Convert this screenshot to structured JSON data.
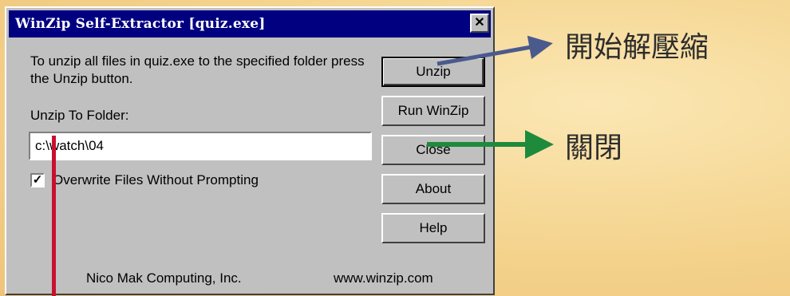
{
  "dialog": {
    "title": "WinZip Self-Extractor [quiz.exe]",
    "close_glyph": "✕",
    "instructions": "To unzip all files in quiz.exe to the specified folder press the Unzip button.",
    "folder_label": "Unzip To Folder:",
    "folder_value": "c:\\watch\\04",
    "overwrite_checked": true,
    "checkbox_glyph": "✓",
    "overwrite_label": "Overwrite Files Without Prompting",
    "buttons": {
      "unzip": "Unzip",
      "run_winzip": "Run WinZip",
      "close": "Close",
      "about": "About",
      "help": "Help"
    },
    "footer": {
      "company": "Nico Mak Computing, Inc.",
      "website": "www.winzip.com"
    }
  },
  "annotations": {
    "unzip": "開始解壓縮",
    "close": "關閉"
  },
  "colors": {
    "titlebar": "#000080",
    "dialog_face": "#c0c0c0",
    "arrow_unzip": "#4b5a8c",
    "arrow_close": "#1e8a3c",
    "highlight_line": "#c8102e",
    "background": "#f4d38d"
  }
}
